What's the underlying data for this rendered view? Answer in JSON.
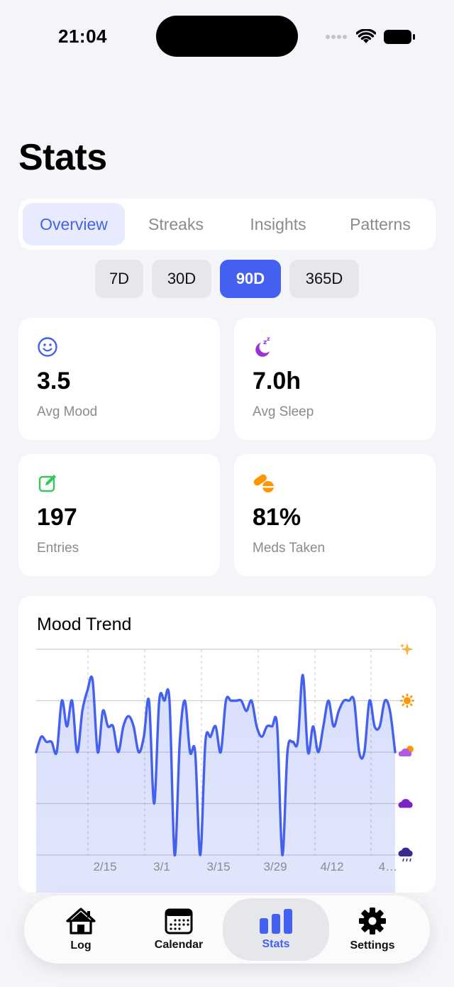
{
  "status": {
    "time": "21:04"
  },
  "page": {
    "title": "Stats"
  },
  "tabs": [
    "Overview",
    "Streaks",
    "Insights",
    "Patterns"
  ],
  "ranges": [
    "7D",
    "30D",
    "90D",
    "365D"
  ],
  "cards": {
    "mood": {
      "value": "3.5",
      "label": "Avg Mood",
      "icon": "smiley-icon"
    },
    "sleep": {
      "value": "7.0h",
      "label": "Avg Sleep",
      "icon": "moon-zzz-icon"
    },
    "entries": {
      "value": "197",
      "label": "Entries",
      "icon": "edit-square-icon"
    },
    "meds": {
      "value": "81%",
      "label": "Meds Taken",
      "icon": "pills-icon"
    }
  },
  "colors": {
    "accent": "#4361ee",
    "green": "#34c759",
    "purple": "#9b30d9",
    "orange": "#ff9500"
  },
  "chart": {
    "title": "Mood Trend"
  },
  "chart_data": {
    "type": "area",
    "title": "Mood Trend",
    "ylim": [
      1,
      5
    ],
    "y_icons": [
      "sparkles-icon",
      "sun-icon",
      "sun-behind-cloud-icon",
      "cloud-icon",
      "rain-cloud-icon"
    ],
    "x_tick_labels": [
      "2/15",
      "3/1",
      "3/15",
      "3/29",
      "4/12",
      "4…"
    ],
    "grid": true,
    "series": [
      {
        "values": [
          3,
          3.3,
          3.2,
          3.2,
          3,
          4,
          3.5,
          4,
          3,
          3.8,
          4.2,
          4.4,
          3,
          3.8,
          3.5,
          3.5,
          3,
          3.5,
          3.7,
          3.5,
          3,
          3.3,
          4,
          2,
          4,
          4,
          4,
          1,
          3.2,
          4,
          3,
          3,
          1,
          3.2,
          3.3,
          3.5,
          3,
          4,
          4,
          4,
          4,
          3.8,
          4,
          3.5,
          3.3,
          3.5,
          3.5,
          3.5,
          1,
          3,
          3.2,
          3.2,
          4.5,
          3,
          3.5,
          3,
          3.5,
          4,
          3.5,
          3.8,
          4,
          4,
          4,
          3,
          3,
          4,
          3.5,
          3.5,
          4,
          3.8,
          3
        ]
      }
    ]
  },
  "tabbar": [
    {
      "label": "Log",
      "icon": "house-icon"
    },
    {
      "label": "Calendar",
      "icon": "calendar-icon"
    },
    {
      "label": "Stats",
      "icon": "bar-chart-icon"
    },
    {
      "label": "Settings",
      "icon": "gear-icon"
    }
  ]
}
